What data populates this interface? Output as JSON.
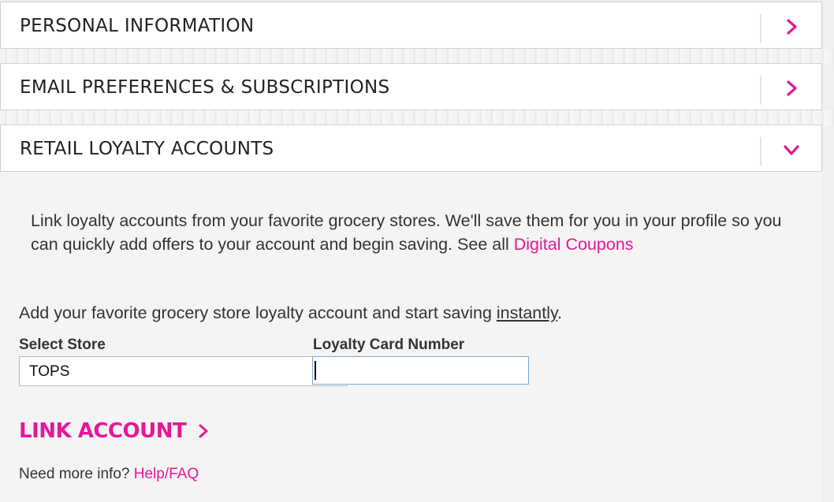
{
  "accordion": [
    {
      "title": "PERSONAL INFORMATION",
      "icon": "chevron-right-icon",
      "expanded": false
    },
    {
      "title": "EMAIL PREFERENCES & SUBSCRIPTIONS",
      "icon": "chevron-right-icon",
      "expanded": false
    },
    {
      "title": "RETAIL LOYALTY ACCOUNTS",
      "icon": "chevron-down-icon",
      "expanded": true
    }
  ],
  "loyalty": {
    "intro_text": "Link loyalty accounts from your favorite grocery stores. We'll save them for you in your profile so you can quickly add offers to your account and begin saving. See all ",
    "intro_link": "Digital Coupons",
    "add_text_before": "Add your favorite grocery store loyalty account and start saving ",
    "add_text_underlined": "instantly",
    "add_text_after": ".",
    "store_label": "Select Store",
    "store_value": "TOPS",
    "card_label": "Loyalty Card Number",
    "card_value": "",
    "link_button": "LINK ACCOUNT",
    "help_text": "Need more info? ",
    "help_link": "Help/FAQ"
  },
  "colors": {
    "accent": "#e5179a",
    "text": "#333333",
    "header_text": "#222222",
    "panel_bg": "#f4f4f4",
    "page_bg": "#efefef"
  }
}
